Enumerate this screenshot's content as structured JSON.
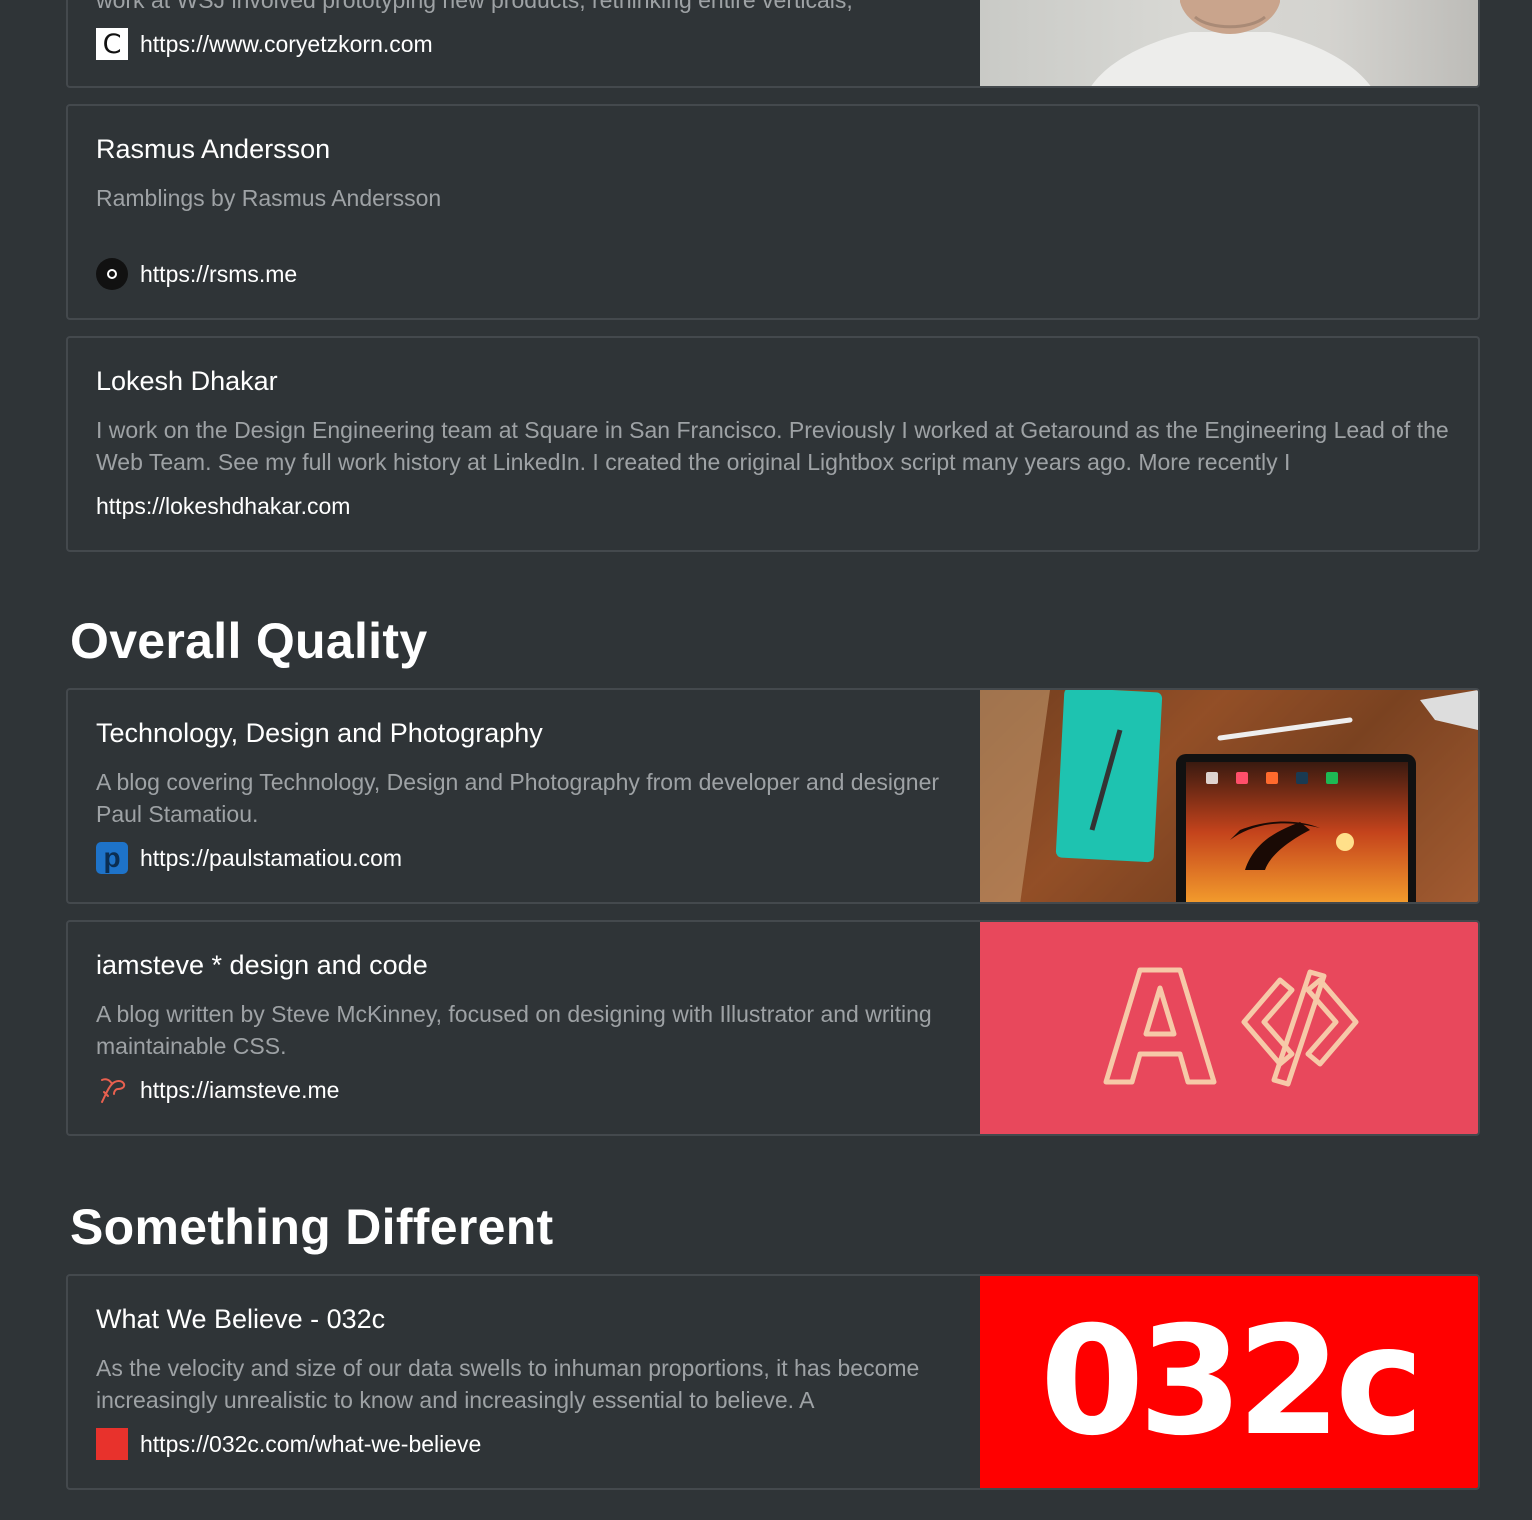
{
  "cards": [
    {
      "desc": "work at WSJ involved prototyping new products, rethinking entire verticals,",
      "url": "https://www.coryetzkorn.com",
      "favicon": "letter-c-icon",
      "favicon_letter": "C"
    },
    {
      "title": "Rasmus Andersson",
      "desc": "Ramblings by Rasmus Andersson",
      "url": "https://rsms.me",
      "favicon": "circle-dot-icon"
    },
    {
      "title": "Lokesh Dhakar",
      "desc": "I work on the Design Engineering team at Square in San Francisco. Previously I worked at Getaround as the Engineering Lead of the Web Team. See my full work history at LinkedIn. I created the original Lightbox script many years ago. More recently I",
      "url": "https://lokeshdhakar.com"
    },
    {
      "title": "Technology, Design and Photography",
      "desc": "A blog covering Technology, Design and Photography from developer and designer Paul Stamatiou.",
      "url": "https://paulstamatiou.com",
      "favicon": "letter-p-icon",
      "favicon_letter": "p"
    },
    {
      "title": "iamsteve * design and code",
      "desc": "A blog written by Steve McKinney, focused on designing with Illustrator and writing maintainable CSS.",
      "url": "https://iamsteve.me",
      "favicon": "bird-icon"
    },
    {
      "title": "What We Believe - 032c",
      "desc": "As the velocity and size of our data swells to inhuman proportions, it has become increasingly unrealistic to know and increasingly essential to believe. A",
      "url": "https://032c.com/what-we-believe",
      "favicon": "red-square-icon",
      "thumb_text": "032c"
    }
  ],
  "sections": {
    "overall_quality": "Overall Quality",
    "something_different": "Something Different"
  },
  "colors": {
    "background": "#2f3437",
    "card_border": "#44494d",
    "title_text": "#ffffff",
    "desc_text": "#9ea2a5",
    "iamsteve_thumb": "#e8485c",
    "thumb_032c": "#ff0000"
  }
}
